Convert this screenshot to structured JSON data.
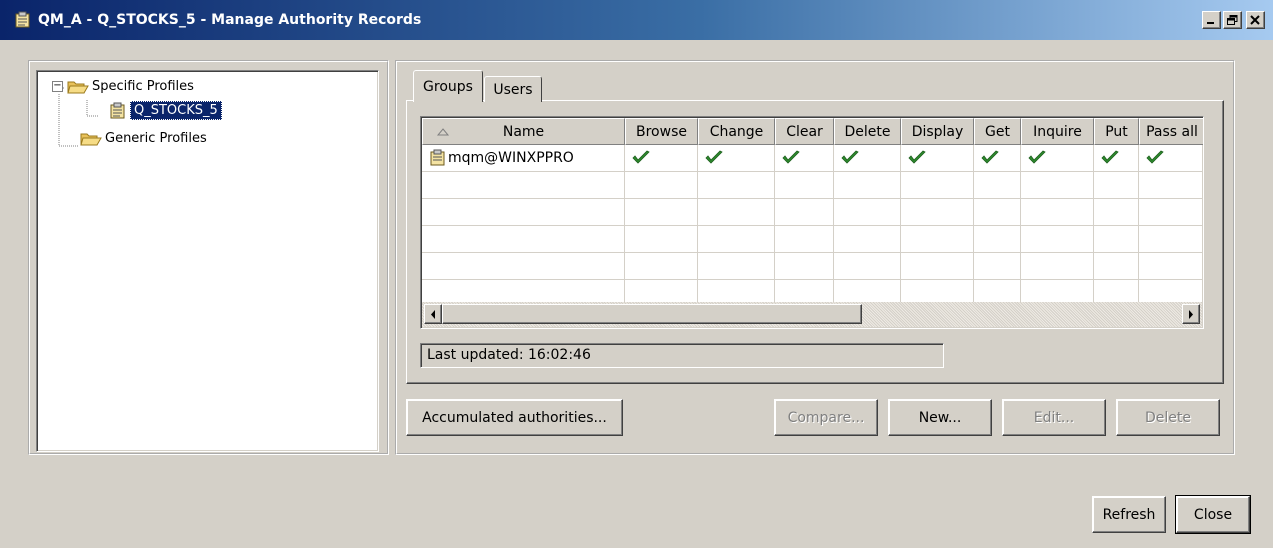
{
  "window": {
    "title": "QM_A - Q_STOCKS_5 - Manage Authority Records",
    "icon": "authority-records-icon"
  },
  "tree": {
    "items": [
      {
        "label": "Specific Profiles",
        "icon": "folder-open-icon",
        "expanded": true
      },
      {
        "label": "Q_STOCKS_5",
        "icon": "profile-icon",
        "selected": true
      },
      {
        "label": "Generic Profiles",
        "icon": "folder-open-icon"
      }
    ]
  },
  "tabs": [
    {
      "label": "Groups",
      "active": true
    },
    {
      "label": "Users",
      "active": false
    }
  ],
  "table": {
    "columns": [
      "Name",
      "Browse",
      "Change",
      "Clear",
      "Delete",
      "Display",
      "Get",
      "Inquire",
      "Put",
      "Pass all"
    ],
    "sort_icon": "sort-ascending-icon",
    "rows": [
      {
        "name": "mqm@WINXPPRO",
        "icon": "group-icon",
        "checks": [
          true,
          true,
          true,
          true,
          true,
          true,
          true,
          true,
          true
        ]
      }
    ],
    "check_color": "#2e8b2e"
  },
  "status": {
    "text": "Last updated: 16:02:46"
  },
  "buttons": {
    "accumulated": "Accumulated authorities...",
    "compare": "Compare...",
    "new": "New...",
    "edit": "Edit...",
    "delete": "Delete",
    "refresh": "Refresh",
    "close": "Close"
  }
}
